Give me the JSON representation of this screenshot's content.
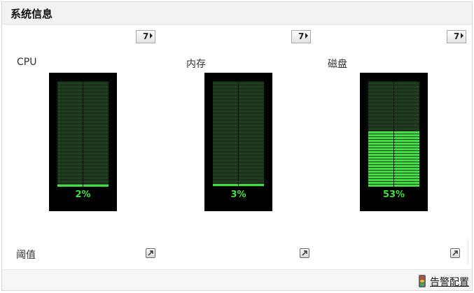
{
  "panel": {
    "title": "系统信息"
  },
  "period_button": {
    "label": "7"
  },
  "metrics": [
    {
      "label": "CPU",
      "percent_text": "2%",
      "value": 2,
      "color": "#3fe03f"
    },
    {
      "label": "内存",
      "percent_text": "3%",
      "value": 3,
      "color": "#3fe03f"
    },
    {
      "label": "磁盘",
      "percent_text": "53%",
      "value": 53,
      "color": "#3fe03f"
    }
  ],
  "threshold": {
    "label": "阈值"
  },
  "footer": {
    "alarm_config_link": "告警配置"
  },
  "icons": [
    "period-arrow-icon",
    "threshold-edit-icon",
    "traffic-light-icon"
  ]
}
